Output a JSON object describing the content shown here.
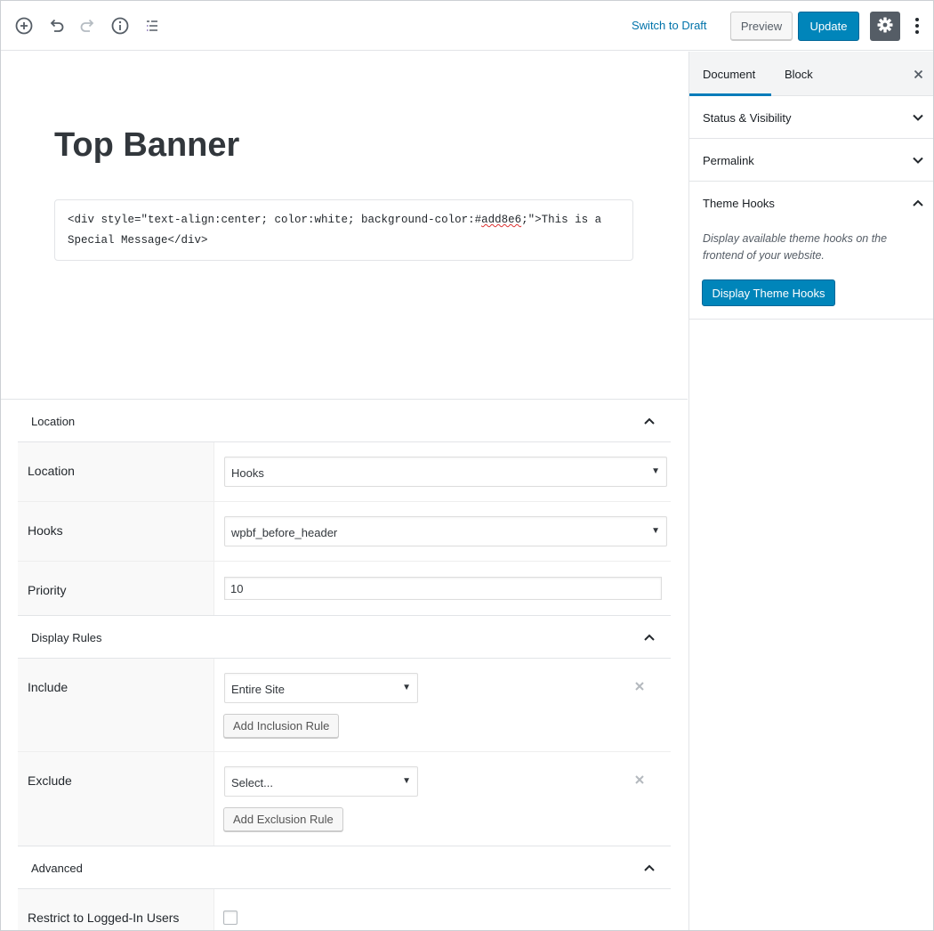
{
  "toolbar": {
    "add_block_icon": "plus-circle-icon",
    "undo_icon": "undo-icon",
    "redo_icon": "redo-icon",
    "info_icon": "info-icon",
    "outline_icon": "list-icon",
    "switch_to_draft": "Switch to Draft",
    "preview": "Preview",
    "update": "Update",
    "settings_icon": "gear-icon",
    "more_icon": "vertical-ellipsis-icon"
  },
  "editor": {
    "title": "Top Banner",
    "html_block": {
      "before_misspelled": "<div style=\"text-align:center; color:white; background-color:#",
      "misspelled": "add8e6",
      "after_misspelled_line1": ";\">This is a",
      "line2": "Special Message</div>"
    }
  },
  "meta": {
    "location_section": {
      "title": "Location",
      "rows": {
        "location": {
          "label": "Location",
          "value": "Hooks"
        },
        "hooks": {
          "label": "Hooks",
          "value": "wpbf_before_header"
        },
        "priority": {
          "label": "Priority",
          "value": "10"
        }
      }
    },
    "display_rules_section": {
      "title": "Display Rules",
      "include": {
        "label": "Include",
        "value": "Entire Site",
        "button": "Add Inclusion Rule"
      },
      "exclude": {
        "label": "Exclude",
        "value": "Select...",
        "button": "Add Exclusion Rule"
      }
    },
    "advanced_section": {
      "title": "Advanced",
      "restrict": {
        "label": "Restrict to Logged-In Users",
        "checked": false
      }
    }
  },
  "sidebar": {
    "tabs": [
      {
        "label": "Document",
        "active": true
      },
      {
        "label": "Block",
        "active": false
      }
    ],
    "panels": [
      {
        "title": "Status & Visibility",
        "expanded": false
      },
      {
        "title": "Permalink",
        "expanded": false
      },
      {
        "title": "Theme Hooks",
        "expanded": true
      }
    ],
    "theme_hooks": {
      "description": "Display available theme hooks on the frontend of your website.",
      "button": "Display Theme Hooks"
    }
  },
  "colors": {
    "accent": "#0085ba",
    "link": "#0073aa",
    "dark_button": "#555d66",
    "border": "#e2e4e7"
  }
}
